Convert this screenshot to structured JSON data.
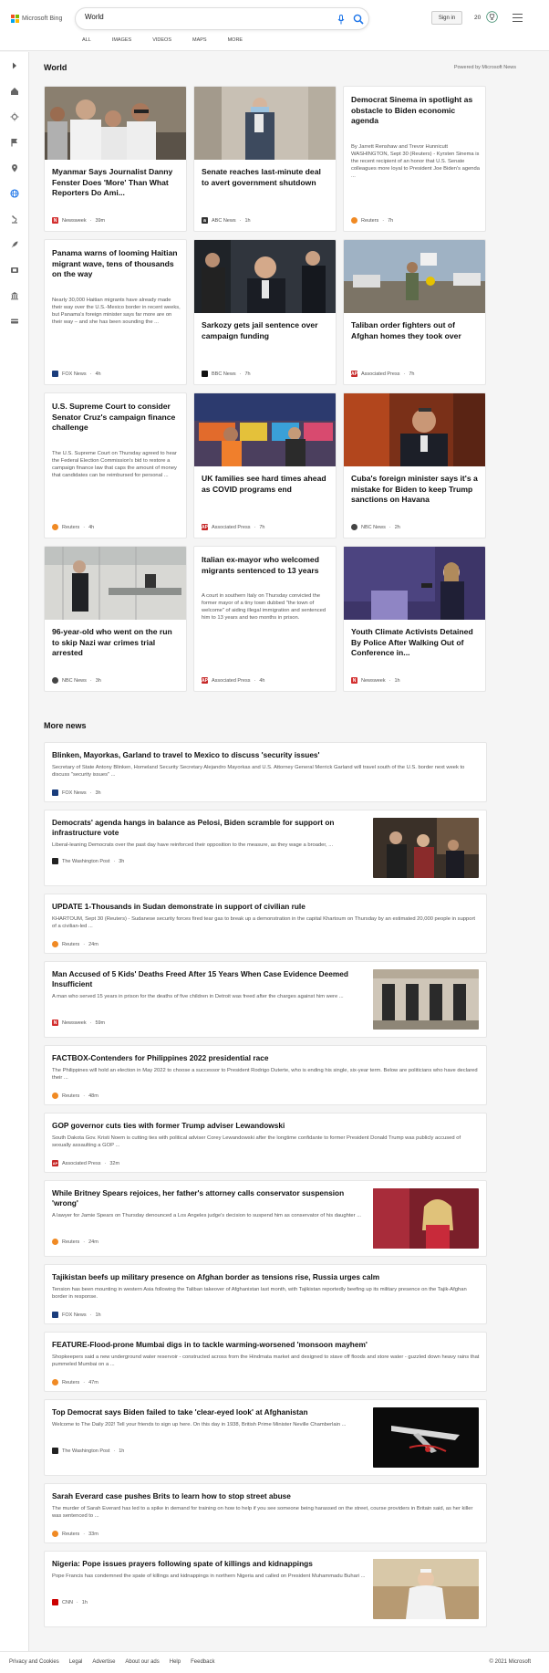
{
  "header": {
    "brand": "Microsoft Bing",
    "search_value": "World",
    "nav": [
      "ALL",
      "IMAGES",
      "VIDEOS",
      "MAPS",
      "MORE"
    ],
    "signin_label": "Sign in",
    "points": "20"
  },
  "section": {
    "title": "World",
    "powered_by": "Powered by Microsoft News"
  },
  "cards": [
    {
      "title": "Myanmar Says Journalist Danny Fenster Does 'More' Than What Reporters Do Ami...",
      "snippet": "",
      "source": "Newsweek",
      "age": "39m",
      "src_color": "#d32f2f",
      "src_letter": "N"
    },
    {
      "title": "Senate reaches last-minute deal to avert government shutdown",
      "snippet": "",
      "source": "ABC News",
      "age": "1h",
      "src_color": "#333333",
      "src_letter": "a"
    },
    {
      "title": "Democrat Sinema in spotlight as obstacle to Biden economic agenda",
      "snippet": "By Jarrett Renshaw and Trevor Hunnicutt WASHINGTON, Sept 30 (Reuters) - Kyrsten Sinema is the recent recipient of an honor that U.S. Senate colleagues more loyal to President Joe Biden's agenda ...",
      "source": "Reuters",
      "age": "7h",
      "src_color": "#f08a24",
      "src_letter": ""
    },
    {
      "title": "Panama warns of looming Haitian migrant wave, tens of thousands on the way",
      "snippet": "Nearly 30,000 Haitian migrants have already made their way over the U.S.-Mexico border in recent weeks, but Panama's foreign minister says far more are on their way – and she has been sounding the ...",
      "source": "FOX News",
      "age": "4h",
      "src_color": "#1a3d7c",
      "src_letter": ""
    },
    {
      "title": "Sarkozy gets jail sentence over campaign funding",
      "snippet": "",
      "source": "BBC News",
      "age": "7h",
      "src_color": "#111111",
      "src_letter": ""
    },
    {
      "title": "Taliban order fighters out of Afghan homes they took over",
      "snippet": "",
      "source": "Associated Press",
      "age": "7h",
      "src_color": "#c62828",
      "src_letter": "AP"
    },
    {
      "title": "U.S. Supreme Court to consider Senator Cruz's campaign finance challenge",
      "snippet": "The U.S. Supreme Court on Thursday agreed to hear the Federal Election Commission's bid to restore a campaign finance law that caps the amount of money that candidates can be reimbursed for personal ...",
      "source": "Reuters",
      "age": "4h",
      "src_color": "#f08a24",
      "src_letter": ""
    },
    {
      "title": "UK families see hard times ahead as COVID programs end",
      "snippet": "",
      "source": "Associated Press",
      "age": "7h",
      "src_color": "#c62828",
      "src_letter": "AP"
    },
    {
      "title": "Cuba's foreign minister says it's a mistake for Biden to keep Trump sanctions on Havana",
      "snippet": "",
      "source": "NBC News",
      "age": "2h",
      "src_color": "#444444",
      "src_letter": ""
    },
    {
      "title": "96-year-old who went on the run to skip Nazi war crimes trial arrested",
      "snippet": "",
      "source": "NBC News",
      "age": "3h",
      "src_color": "#444444",
      "src_letter": ""
    },
    {
      "title": "Italian ex-mayor who welcomed migrants sentenced to 13 years",
      "snippet": "A court in southern Italy on Thursday convicted the former mayor of a tiny town dubbed \"the town of welcome\" of aiding illegal immigration and sentenced him to 13 years and two months in prison.",
      "source": "Associated Press",
      "age": "4h",
      "src_color": "#c62828",
      "src_letter": "AP"
    },
    {
      "title": "Youth Climate Activists Detained By Police After Walking Out of Conference in...",
      "snippet": "",
      "source": "Newsweek",
      "age": "1h",
      "src_color": "#d32f2f",
      "src_letter": "N"
    }
  ],
  "more_news": {
    "title": "More news",
    "items": [
      {
        "title": "Blinken, Mayorkas, Garland to travel to Mexico to discuss 'security issues'",
        "snippet": "Secretary of State Antony Blinken, Homeland Security Secretary Alejandro Mayorkas and U.S. Attorney General Merrick Garland will travel south of the U.S. border next week to discuss \"security issues\" ...",
        "source": "FOX News",
        "age": "3h",
        "src_color": "#1a3d7c"
      },
      {
        "title": "Democrats' agenda hangs in balance as Pelosi, Biden scramble for support on infrastructure vote",
        "snippet": "Liberal-leaning Democrats over the past day have reinforced their opposition to the measure, as they wage a broader, ...",
        "source": "The Washington Post",
        "age": "3h",
        "src_color": "#222222"
      },
      {
        "title": "UPDATE 1-Thousands in Sudan demonstrate in support of civilian rule",
        "snippet": "KHARTOUM, Sept 30 (Reuters) - Sudanese security forces fired tear gas to break up a demonstration in the capital Khartoum on Thursday by an estimated 20,000 people in support of a civilian-led ...",
        "source": "Reuters",
        "age": "24m",
        "src_color": "#f08a24"
      },
      {
        "title": "Man Accused of 5 Kids' Deaths Freed After 15 Years When Case Evidence Deemed Insufficient",
        "snippet": "A man who served 15 years in prison for the deaths of five children in Detroit was freed after the charges against him were ...",
        "source": "Newsweek",
        "age": "59m",
        "src_color": "#d32f2f"
      },
      {
        "title": "FACTBOX-Contenders for Philippines 2022 presidential race",
        "snippet": "The Philippines will hold an election in May 2022 to choose a successor to President Rodrigo Duterte, who is ending his single, six-year term. Below are politicians who have declared their ...",
        "source": "Reuters",
        "age": "48m",
        "src_color": "#f08a24"
      },
      {
        "title": "GOP governor cuts ties with former Trump adviser Lewandowski",
        "snippet": "South Dakota Gov. Kristi Noem is cutting ties with political adviser Corey Lewandowski after the longtime confidante to former President Donald Trump was publicly accused of sexually assaulting a GOP ...",
        "source": "Associated Press",
        "age": "32m",
        "src_color": "#c62828"
      },
      {
        "title": "While Britney Spears rejoices, her father's attorney calls conservator suspension 'wrong'",
        "snippet": "A lawyer for Jamie Spears on Thursday denounced a Los Angeles judge's decision to suspend him as conservator of his daughter ...",
        "source": "Reuters",
        "age": "24m",
        "src_color": "#f08a24"
      },
      {
        "title": "Tajikistan beefs up military presence on Afghan border as tensions rise, Russia urges calm",
        "snippet": "Tension has been mounting in western Asia following the Taliban takeover of Afghanistan last month, with Tajikistan reportedly beefing up its military presence on the Tajik-Afghan border in response.",
        "source": "FOX News",
        "age": "1h",
        "src_color": "#1a3d7c"
      },
      {
        "title": "FEATURE-Flood-prone Mumbai digs in to tackle warming-worsened 'monsoon mayhem'",
        "snippet": "Shopkeepers said a new underground water reservoir - constructed across from the Hindmata market and designed to stave off floods and store water - guzzled down heavy rains that pummeled Mumbai on a ...",
        "source": "Reuters",
        "age": "47m",
        "src_color": "#f08a24"
      },
      {
        "title": "Top Democrat says Biden failed to take 'clear-eyed look' at Afghanistan",
        "snippet": "Welcome to The Daily 202! Tell your friends to sign up here. On this day in 1938, British Prime Minister Neville Chamberlain ...",
        "source": "The Washington Post",
        "age": "1h",
        "src_color": "#222222"
      },
      {
        "title": "Sarah Everard case pushes Brits to learn how to stop street abuse",
        "snippet": "The murder of Sarah Everard has led to a spike in demand for training on how to help if you see someone being harassed on the street, course providers in Britain said, as her killer was sentenced to ...",
        "source": "Reuters",
        "age": "33m",
        "src_color": "#f08a24"
      },
      {
        "title": "Nigeria: Pope issues prayers following spate of killings and kidnappings",
        "snippet": "Pope Francis has condemned the spate of killings and kidnappings in northern Nigeria and called on President Muhammadu Buhari ...",
        "source": "CNN",
        "age": "1h",
        "src_color": "#cc0000"
      }
    ]
  },
  "footer": {
    "links": [
      "Privacy and Cookies",
      "Legal",
      "Advertise",
      "About our ads",
      "Help",
      "Feedback"
    ],
    "copyright": "© 2021 Microsoft"
  }
}
